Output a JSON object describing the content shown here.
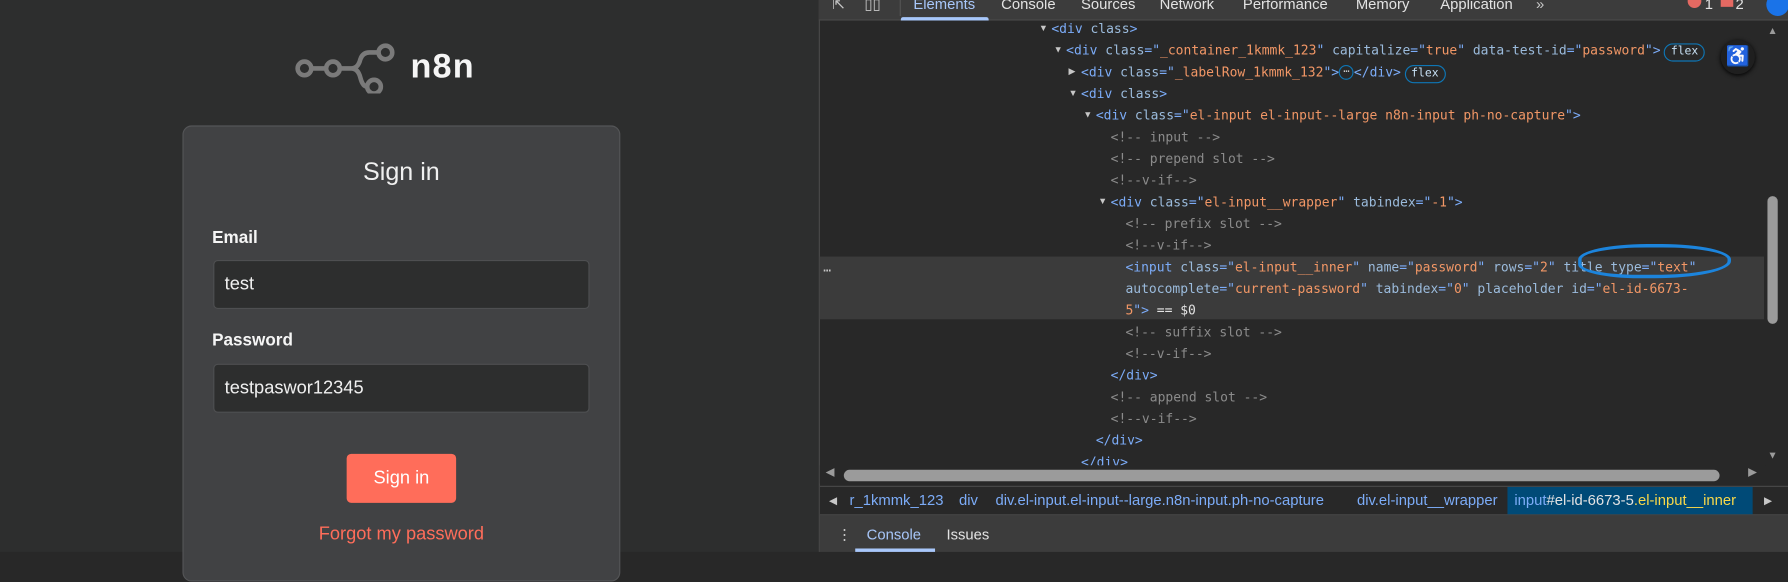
{
  "app": {
    "logo_text": "n8n",
    "title": "Sign in",
    "email_label": "Email",
    "email_value": "test",
    "password_label": "Password",
    "password_value": "testpaswor12345",
    "signin_button": "Sign in",
    "forgot_link": "Forgot my password",
    "accent_color": "#ff6d5a"
  },
  "devtools": {
    "tabs": [
      "Elements",
      "Console",
      "Sources",
      "Network",
      "Performance",
      "Memory",
      "Application"
    ],
    "more_tabs": "»",
    "error_count": "1",
    "issue_count": "2",
    "selected_marker": "…",
    "dom_lines": [
      {
        "depth": 0,
        "toggle": "open",
        "parts": [
          [
            "tag",
            "<div "
          ],
          [
            "attr",
            "class"
          ],
          [
            "tag",
            ">"
          ]
        ]
      },
      {
        "depth": 1,
        "toggle": "open",
        "parts": [
          [
            "tag",
            "<div "
          ],
          [
            "attr",
            "class"
          ],
          [
            "tag",
            "=\""
          ],
          [
            "val",
            "_container_1kmmk_123"
          ],
          [
            "tag",
            "\" "
          ],
          [
            "attr",
            "capitalize"
          ],
          [
            "tag",
            "=\""
          ],
          [
            "val",
            "true"
          ],
          [
            "tag",
            "\" "
          ],
          [
            "attr",
            "data-test-id"
          ],
          [
            "tag",
            "=\""
          ],
          [
            "val",
            "password"
          ],
          [
            "tag",
            "\">"
          ]
        ],
        "badge": "flex"
      },
      {
        "depth": 2,
        "toggle": "closed",
        "parts": [
          [
            "tag",
            "<div "
          ],
          [
            "attr",
            "class"
          ],
          [
            "tag",
            "=\""
          ],
          [
            "val",
            "_labelRow_1kmmk_132"
          ],
          [
            "tag",
            "\">"
          ]
        ],
        "ellipsis": "…",
        "after": "</div>",
        "badge": "flex"
      },
      {
        "depth": 2,
        "toggle": "open",
        "parts": [
          [
            "tag",
            "<div "
          ],
          [
            "attr",
            "class"
          ],
          [
            "tag",
            ">"
          ]
        ]
      },
      {
        "depth": 3,
        "toggle": "open",
        "parts": [
          [
            "tag",
            "<div "
          ],
          [
            "attr",
            "class"
          ],
          [
            "tag",
            "=\""
          ],
          [
            "val",
            "el-input el-input--large n8n-input ph-no-capture"
          ],
          [
            "tag",
            "\">"
          ]
        ]
      },
      {
        "depth": 4,
        "parts": [
          [
            "com",
            "<!-- input -->"
          ]
        ]
      },
      {
        "depth": 4,
        "parts": [
          [
            "com",
            "<!-- prepend slot -->"
          ]
        ]
      },
      {
        "depth": 4,
        "parts": [
          [
            "com",
            "<!--v-if-->"
          ]
        ]
      },
      {
        "depth": 4,
        "toggle": "open",
        "parts": [
          [
            "tag",
            "<div "
          ],
          [
            "attr",
            "class"
          ],
          [
            "tag",
            "=\""
          ],
          [
            "val",
            "el-input__wrapper"
          ],
          [
            "tag",
            "\" "
          ],
          [
            "attr",
            "tabindex"
          ],
          [
            "tag",
            "=\""
          ],
          [
            "val",
            "-1"
          ],
          [
            "tag",
            "\">"
          ]
        ]
      },
      {
        "depth": 5,
        "parts": [
          [
            "com",
            "<!-- prefix slot -->"
          ]
        ]
      },
      {
        "depth": 5,
        "parts": [
          [
            "com",
            "<!--v-if-->"
          ]
        ]
      },
      {
        "depth": 5,
        "parts": [
          [
            "tag",
            "<input "
          ],
          [
            "attr",
            "class"
          ],
          [
            "tag",
            "=\""
          ],
          [
            "val",
            "el-input__inner"
          ],
          [
            "tag",
            "\" "
          ],
          [
            "attr",
            "name"
          ],
          [
            "tag",
            "=\""
          ],
          [
            "val",
            "password"
          ],
          [
            "tag",
            "\" "
          ],
          [
            "attr",
            "rows"
          ],
          [
            "tag",
            "=\""
          ],
          [
            "val",
            "2"
          ],
          [
            "tag",
            "\" "
          ],
          [
            "attr",
            "title type"
          ],
          [
            "tag",
            "=\""
          ],
          [
            "val",
            "text"
          ],
          [
            "tag",
            "\""
          ]
        ]
      },
      {
        "depth": 5,
        "parts": [
          [
            "attr",
            "autocomplete"
          ],
          [
            "tag",
            "=\""
          ],
          [
            "val",
            "current-password"
          ],
          [
            "tag",
            "\" "
          ],
          [
            "attr",
            "tabindex"
          ],
          [
            "tag",
            "=\""
          ],
          [
            "val",
            "0"
          ],
          [
            "tag",
            "\" "
          ],
          [
            "attr",
            "placeholder id"
          ],
          [
            "tag",
            "=\""
          ],
          [
            "val",
            "el-id-6673-"
          ]
        ]
      },
      {
        "depth": 5,
        "parts": [
          [
            "val",
            "5"
          ],
          [
            "tag",
            "\">"
          ],
          [
            "txt",
            " == $0"
          ]
        ]
      },
      {
        "depth": 5,
        "parts": [
          [
            "com",
            "<!-- suffix slot -->"
          ]
        ]
      },
      {
        "depth": 5,
        "parts": [
          [
            "com",
            "<!--v-if-->"
          ]
        ]
      },
      {
        "depth": 4,
        "parts": [
          [
            "tag",
            "</div>"
          ]
        ]
      },
      {
        "depth": 4,
        "parts": [
          [
            "com",
            "<!-- append slot -->"
          ]
        ]
      },
      {
        "depth": 4,
        "parts": [
          [
            "com",
            "<!--v-if-->"
          ]
        ]
      },
      {
        "depth": 3,
        "parts": [
          [
            "tag",
            "</div>"
          ]
        ]
      },
      {
        "depth": 2,
        "parts": [
          [
            "tag",
            "</div>"
          ]
        ]
      }
    ],
    "breadcrumbs": [
      "r_1kmmk_123",
      "div",
      "div.el-input.el-input--large.n8n-input.ph-no-capture",
      "div.el-input__wrapper"
    ],
    "breadcrumb_selected": {
      "tag": "input",
      "id": "#el-id-6673-5",
      "cls": ".el-input__inner"
    },
    "drawer_tabs": [
      "Console",
      "Issues"
    ]
  }
}
